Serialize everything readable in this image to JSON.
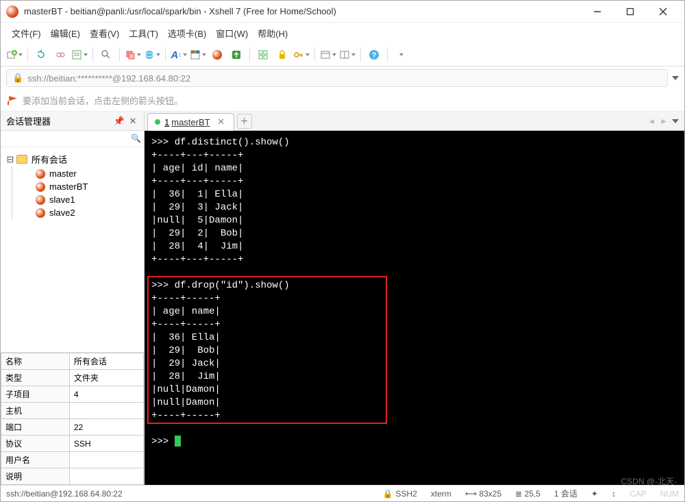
{
  "window": {
    "title": "masterBT - beitian@panli:/usr/local/spark/bin - Xshell 7 (Free for Home/School)"
  },
  "menu": {
    "file": "文件(F)",
    "edit": "编辑(E)",
    "view": "查看(V)",
    "tools": "工具(T)",
    "tabs": "选项卡(B)",
    "window": "窗口(W)",
    "help": "帮助(H)"
  },
  "address_bar": {
    "url": "ssh://beitian:**********@192.168.64.80:22"
  },
  "notice": {
    "text": "要添加当前会话，点击左侧的箭头按钮。"
  },
  "sidebar": {
    "title": "会话管理器",
    "root": "所有会话",
    "items": [
      "master",
      "masterBT",
      "slave1",
      "slave2"
    ]
  },
  "properties": {
    "rows": [
      {
        "k": "名称",
        "v": "所有会话"
      },
      {
        "k": "类型",
        "v": "文件夹"
      },
      {
        "k": "子项目",
        "v": "4"
      },
      {
        "k": "主机",
        "v": ""
      },
      {
        "k": "端口",
        "v": "22"
      },
      {
        "k": "协议",
        "v": "SSH"
      },
      {
        "k": "用户名",
        "v": ""
      },
      {
        "k": "说明",
        "v": ""
      }
    ]
  },
  "tabs": {
    "active": {
      "index": "1",
      "label": "masterBT"
    }
  },
  "terminal": {
    "block1": ">>> df.distinct().show()\n+----+---+-----+\n| age| id| name|\n+----+---+-----+\n|  36|  1| Ella|\n|  29|  3| Jack|\n|null|  5|Damon|\n|  29|  2|  Bob|\n|  28|  4|  Jim|\n+----+---+-----+\n",
    "block2": ">>> df.drop(\"id\").show()\n+----+-----+\n| age| name|\n+----+-----+\n|  36| Ella|\n|  29|  Bob|\n|  29| Jack|\n|  28|  Jim|\n|null|Damon|\n|null|Damon|\n+----+-----+\n",
    "prompt": ">>> "
  },
  "status": {
    "path": "ssh://beitian@192.168.64.80:22",
    "proto": "SSH2",
    "term": "xterm",
    "size": "83x25",
    "pos": "25,5",
    "sessions_label": "1 会话",
    "cap": "CAP",
    "num": "NUM"
  },
  "watermark": "CSDN @-北天-",
  "chart_data": [
    {
      "type": "table",
      "title": "df.distinct().show()",
      "columns": [
        "age",
        "id",
        "name"
      ],
      "rows": [
        {
          "age": 36,
          "id": 1,
          "name": "Ella"
        },
        {
          "age": 29,
          "id": 3,
          "name": "Jack"
        },
        {
          "age": null,
          "id": 5,
          "name": "Damon"
        },
        {
          "age": 29,
          "id": 2,
          "name": "Bob"
        },
        {
          "age": 28,
          "id": 4,
          "name": "Jim"
        }
      ]
    },
    {
      "type": "table",
      "title": "df.drop(\"id\").show()",
      "columns": [
        "age",
        "name"
      ],
      "rows": [
        {
          "age": 36,
          "name": "Ella"
        },
        {
          "age": 29,
          "name": "Bob"
        },
        {
          "age": 29,
          "name": "Jack"
        },
        {
          "age": 28,
          "name": "Jim"
        },
        {
          "age": null,
          "name": "Damon"
        },
        {
          "age": null,
          "name": "Damon"
        }
      ]
    }
  ]
}
